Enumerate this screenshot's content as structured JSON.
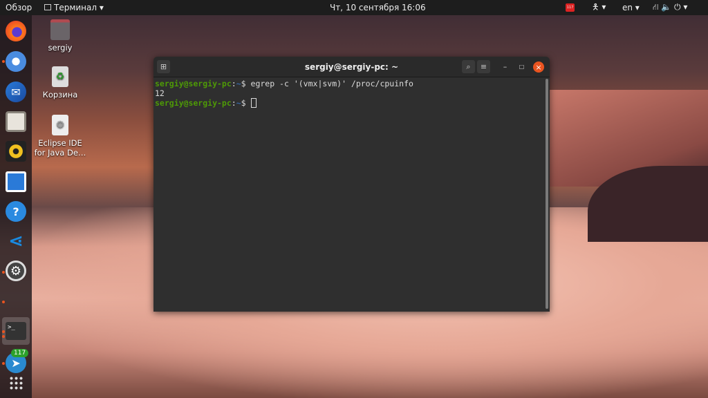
{
  "topbar": {
    "activities": "Обзор",
    "app_menu": "Терминал ▾",
    "clock": "Чт, 10 сентября  16:06",
    "notif_badge": "117",
    "accessibility": "▾",
    "lang": "en ▾",
    "system": "▾"
  },
  "desktop": {
    "icons": [
      {
        "label": "sergiy",
        "icon": "home-folder-icon"
      },
      {
        "label": "Корзина",
        "icon": "trash-icon"
      },
      {
        "label": "Eclipse IDE for Java De…",
        "icon": "eclipse-icon"
      }
    ]
  },
  "dock": {
    "apps": [
      "Firefox",
      "Chromium",
      "Thunderbird",
      "Files",
      "Rhythmbox",
      "LibreOffice Writer",
      "Help",
      "Visual Studio Code",
      "Settings",
      "Terminal",
      "Telegram",
      "Show Applications"
    ],
    "telegram_badge": "117"
  },
  "terminal": {
    "title": "sergiy@sergiy-pc: ~",
    "prompt_user": "sergiy@sergiy-pc",
    "prompt_sep": ":",
    "prompt_path": "~",
    "prompt_sym": "$ ",
    "command": "egrep -c '(vmx|svm)' /proc/cpuinfo",
    "output": "12",
    "colors": {
      "user": "#4e9a06",
      "path": "#3465a4",
      "close": "#e95420"
    }
  }
}
